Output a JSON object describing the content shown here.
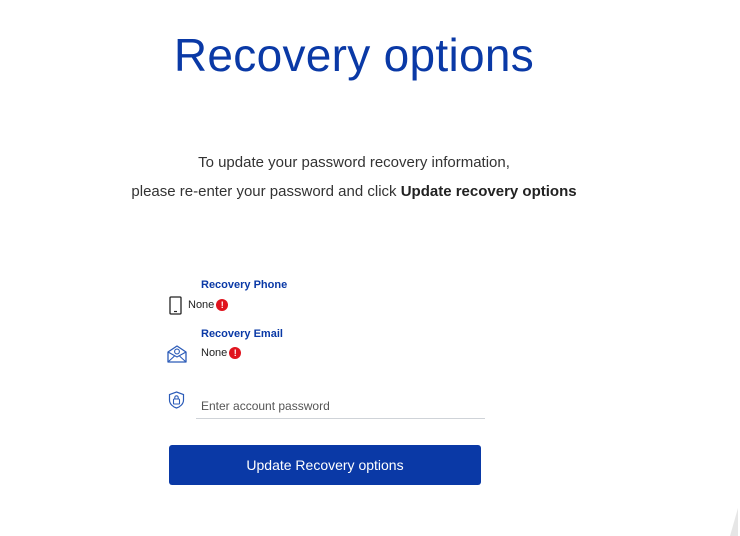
{
  "page": {
    "title": "Recovery options",
    "instructions_line1": "To update your password recovery information,",
    "instructions_line2_prefix": "please re-enter your password and click ",
    "instructions_line2_bold": "Update recovery options"
  },
  "recovery_phone": {
    "label": "Recovery Phone",
    "value": "None",
    "icon": "mobile-phone-icon"
  },
  "recovery_email": {
    "label": "Recovery Email",
    "value": "None",
    "icon": "envelope-icon"
  },
  "status_badge": "!",
  "password": {
    "placeholder": "Enter account password",
    "value": "",
    "icon": "shield-lock-icon"
  },
  "submit": {
    "label": "Update Recovery options"
  },
  "colors": {
    "brand_blue": "#0a39a6",
    "warning_red": "#e0141e",
    "text": "#333333"
  }
}
